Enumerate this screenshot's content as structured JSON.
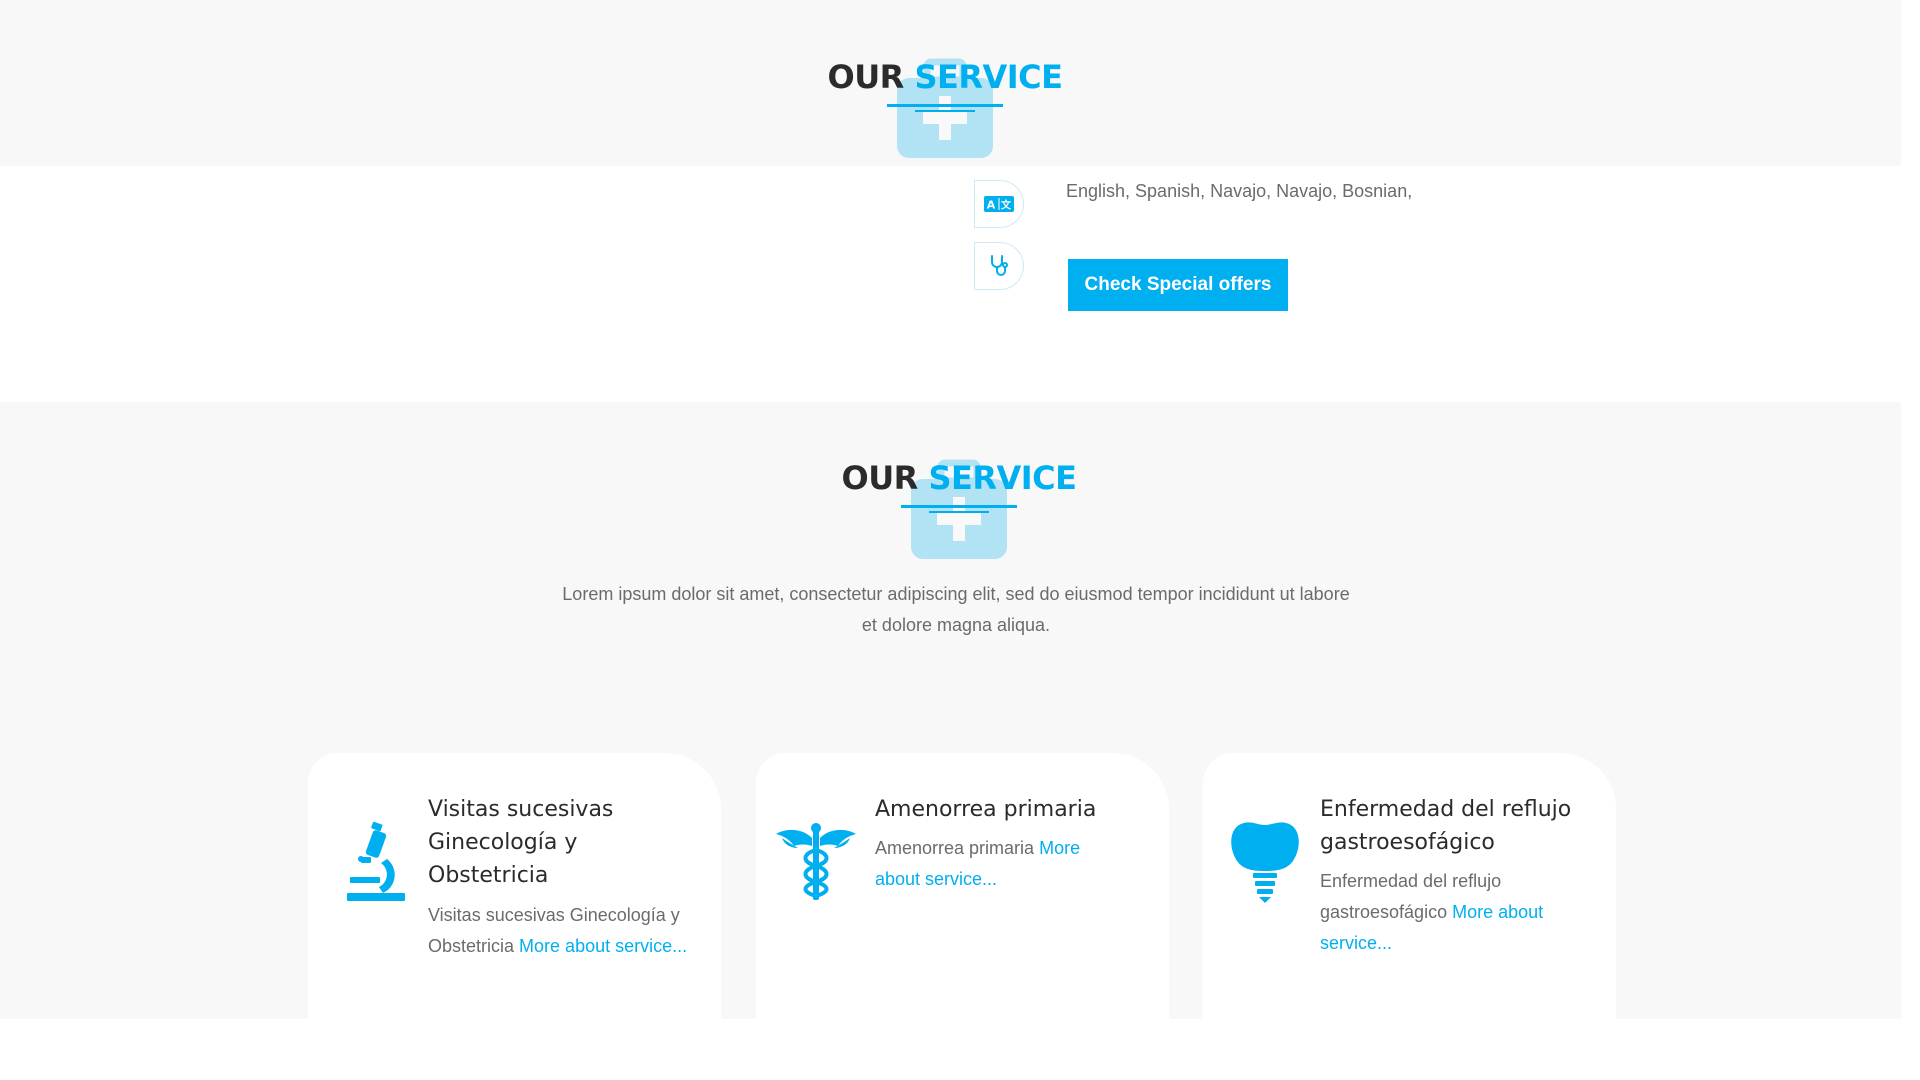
{
  "top_section": {
    "heading_main": "OUR",
    "heading_accent": "SERVICE",
    "icon": "medical-kit-icon"
  },
  "languages": {
    "icon": "translate-icon",
    "text": "English, Spanish, Navajo, Navajo, Bosnian,"
  },
  "specialty": {
    "icon": "stethoscope-icon"
  },
  "offers_button": {
    "label": "Check Special offers"
  },
  "service_section": {
    "heading_main": "OUR",
    "heading_accent": "SERVICE",
    "icon": "medical-kit-icon",
    "description": "Lorem ipsum dolor sit amet, consectetur adipiscing elit, sed do eiusmod tempor incididunt ut labore et dolore magna aliqua.",
    "cards": [
      {
        "icon": "microscope-icon",
        "title": "Visitas sucesivas Ginecología y Obstetricia",
        "text": "Visitas sucesivas Ginecología y Obstetricia",
        "link": "More about service..."
      },
      {
        "icon": "caduceus-icon",
        "title": "Amenorrea primaria",
        "text": "Amenorrea primaria",
        "link": "More about service..."
      },
      {
        "icon": "dental-implant-icon",
        "title": "Enfermedad del reflujo gastroesofágico",
        "text": "Enfermedad del reflujo gastroesofágico",
        "link": "More about service..."
      }
    ]
  },
  "colors": {
    "accent": "#00aff0",
    "heading": "#2b2b2b",
    "body_text": "#6b6b6b",
    "section_bg": "#f8f8f8"
  }
}
